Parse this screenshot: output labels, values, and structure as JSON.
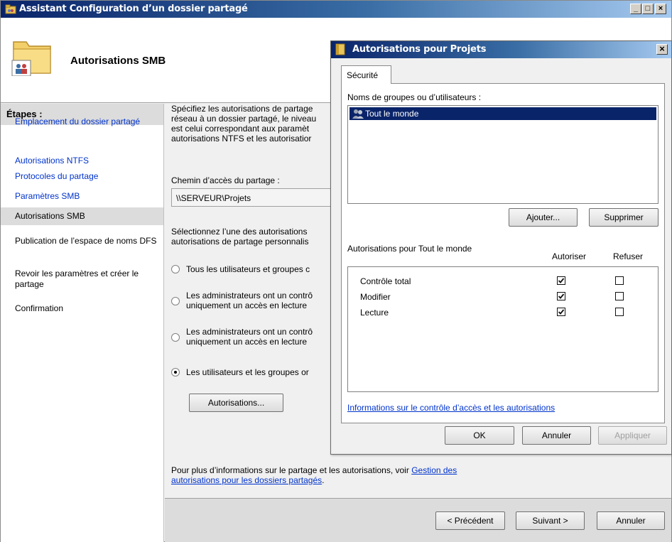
{
  "wizard": {
    "title": "Assistant Configuration d’un dossier partagé",
    "header_title": "Autorisations SMB",
    "sidebar": {
      "heading": "Étapes :",
      "items": [
        {
          "label": "Emplacement du dossier partagé"
        },
        {
          "label": "Autorisations NTFS"
        },
        {
          "label": "Protocoles du partage"
        },
        {
          "label": "Paramètres SMB"
        },
        {
          "label": "Autorisations SMB"
        },
        {
          "label": "Publication de l’espace de noms DFS"
        },
        {
          "label": "Revoir les paramètres et créer le partage"
        },
        {
          "label": "Confirmation"
        }
      ]
    },
    "intro_lines": [
      "Spécifiez les autorisations de partage",
      "réseau à un dossier partagé, le niveau",
      "est celui correspondant aux paramèt",
      "autorisations NTFS et les autorisatior"
    ],
    "share_path_label": "Chemin d’accès du partage :",
    "share_path_value": "\\\\SERVEUR\\Projets",
    "select_lines": [
      "Sélectionnez l’une des autorisations",
      "autorisations de partage personnalis"
    ],
    "options": [
      {
        "line1": "Tous les utilisateurs et groupes c",
        "line2": "",
        "selected": false
      },
      {
        "line1": "Les administrateurs ont un contrô",
        "line2": "uniquement un accès en lecture",
        "selected": false
      },
      {
        "line1": "Les administrateurs ont un contrô",
        "line2": "uniquement un accès en lecture",
        "selected": false
      },
      {
        "line1": "Les utilisateurs et les groupes or",
        "line2": "",
        "selected": true
      }
    ],
    "autorisations_button": "Autorisations...",
    "info_text": "Pour plus d’informations sur le partage et les autorisations, voir",
    "info_link_1": "Gestion des",
    "info_link_2": "autorisations pour les dossiers partagés",
    "info_link_tail": ".",
    "buttons": {
      "previous": "< Précédent",
      "next": "Suivant >",
      "cancel": "Annuler"
    }
  },
  "dialog": {
    "title": "Autorisations pour Projets",
    "close": "×",
    "tab_label": "Sécurité",
    "groups_label": "Noms de groupes ou d’utilisateurs :",
    "groups": [
      {
        "name": "Tout le monde",
        "selected": true
      }
    ],
    "add_button": "Ajouter...",
    "remove_button": "Supprimer",
    "permissions_for": "Autorisations pour Tout le monde",
    "col_allow": "Autoriser",
    "col_deny": "Refuser",
    "permissions": [
      {
        "name": "Contrôle total",
        "allow": true,
        "deny": false
      },
      {
        "name": "Modifier",
        "allow": true,
        "deny": false
      },
      {
        "name": "Lecture",
        "allow": true,
        "deny": false
      }
    ],
    "info_link": "Informations sur le contrôle d’accès et les autorisations",
    "ok_button": "OK",
    "cancel_button": "Annuler",
    "apply_button": "Appliquer"
  },
  "colors": {
    "title_bar_start": "#0a246a",
    "title_bar_end": "#a6caf0",
    "link": "#0033cc",
    "selection": "#0a246a"
  }
}
